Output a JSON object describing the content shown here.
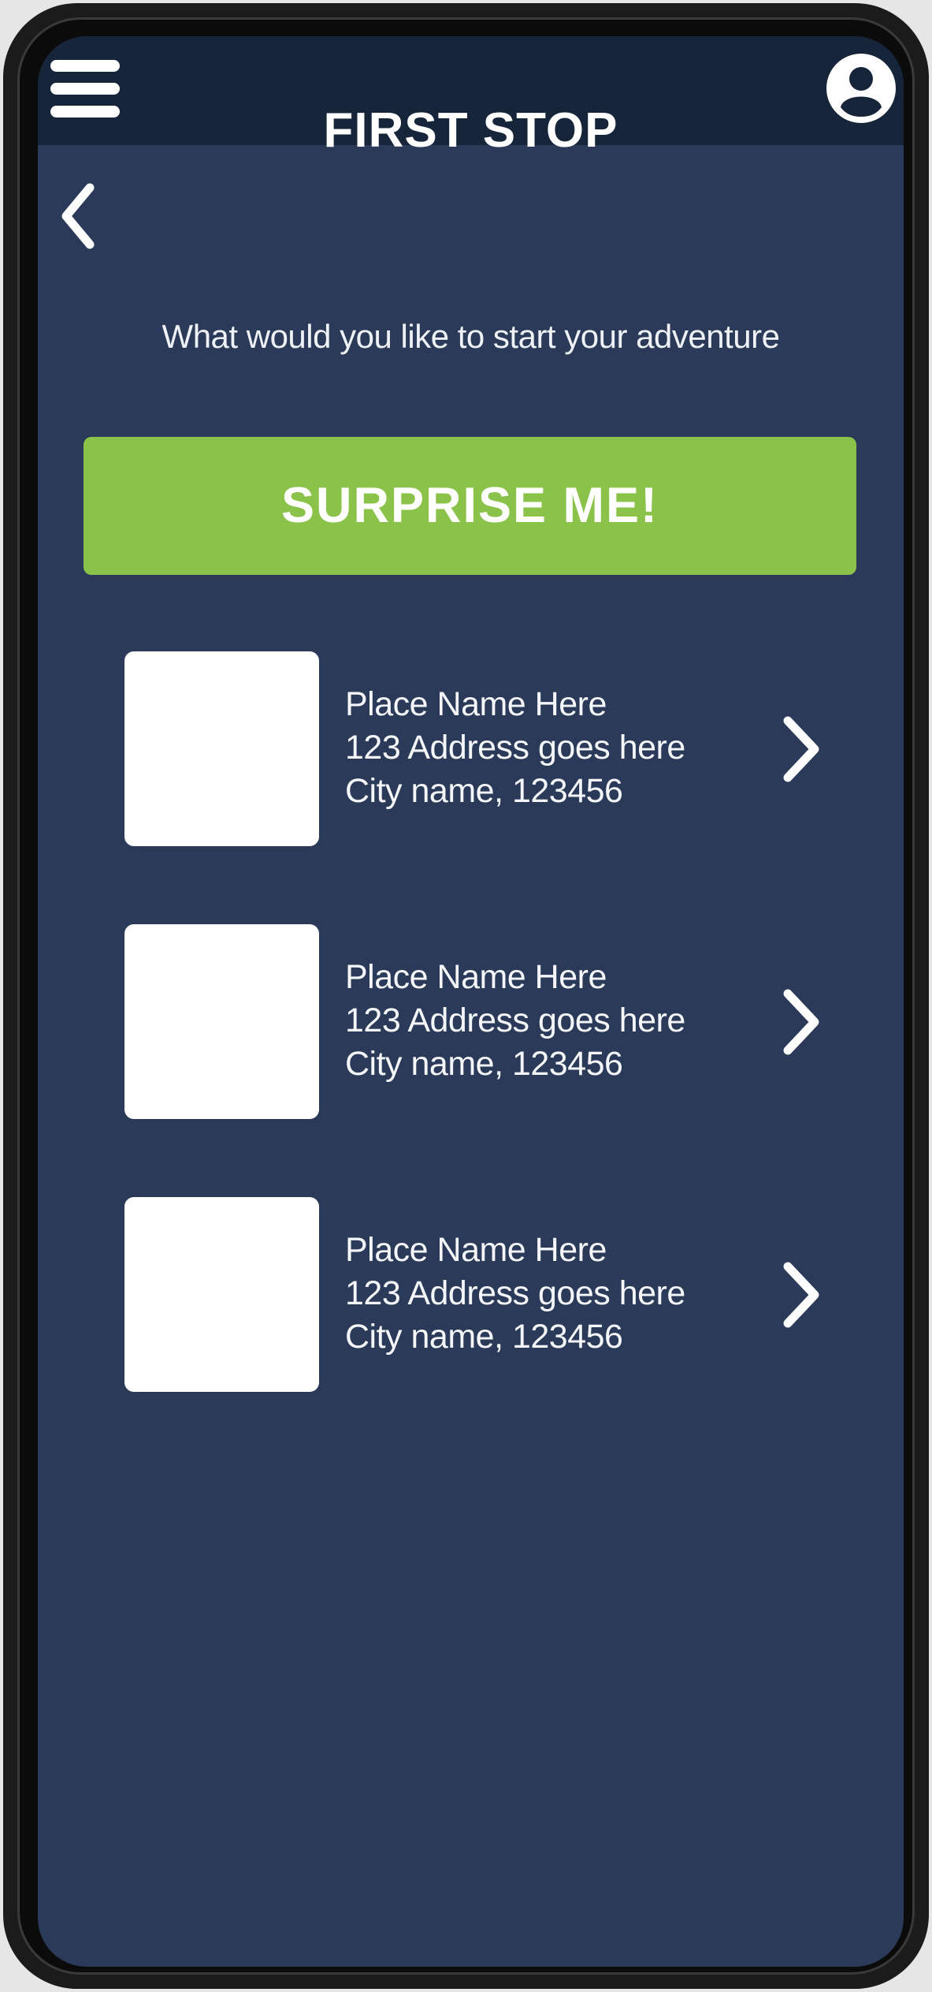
{
  "app": {
    "colors": {
      "background": "#2a3a58",
      "topbar": "#17253b",
      "accent": "#8bc34a",
      "text": "#ffffff"
    }
  },
  "topbar": {
    "menu_icon": "hamburger-menu-icon",
    "profile_icon": "user-profile-icon"
  },
  "header": {
    "back_icon": "chevron-left-icon",
    "title": "FIRST STOP"
  },
  "main": {
    "subtitle": "What would you like to start your adventure",
    "surprise_button": "SURPRISE ME!",
    "places": [
      {
        "name": "Place Name Here",
        "address": "123 Address goes here",
        "city": "City name, 123456"
      },
      {
        "name": "Place Name Here",
        "address": "123 Address goes here",
        "city": "City name, 123456"
      },
      {
        "name": "Place Name Here",
        "address": "123 Address goes here",
        "city": "City name, 123456"
      }
    ]
  }
}
